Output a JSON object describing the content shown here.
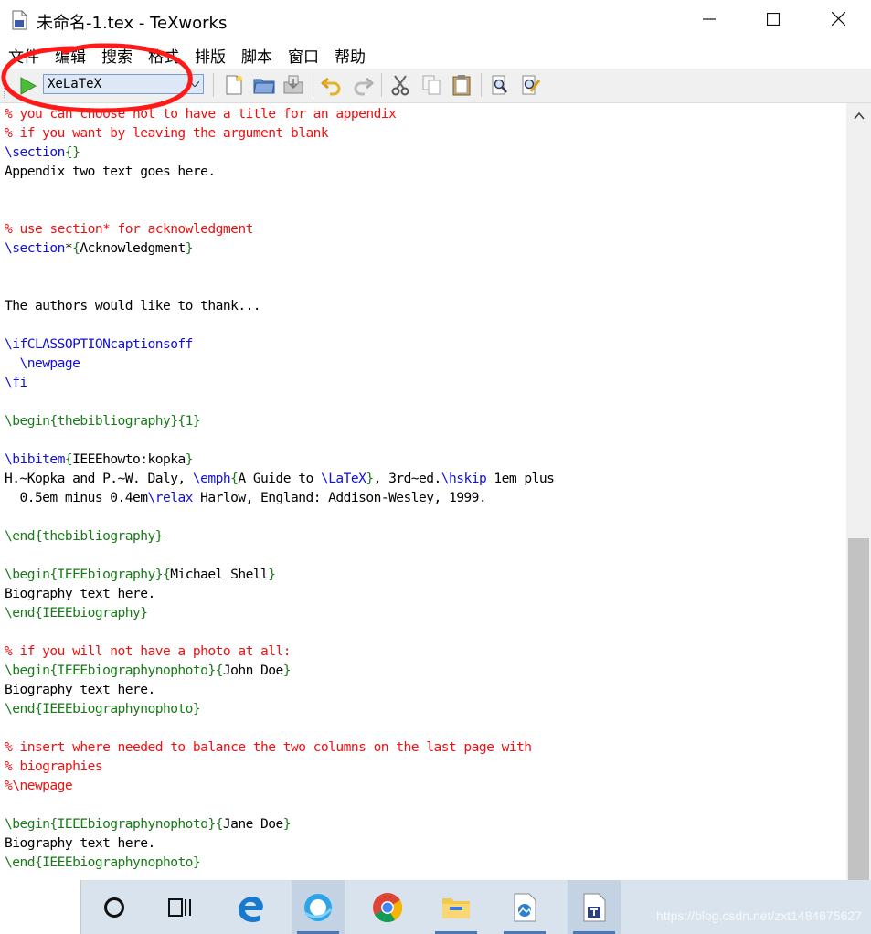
{
  "window": {
    "title": "未命名-1.tex - TeXworks",
    "minimize": "—",
    "maximize": "☐",
    "close": "✕"
  },
  "menu": [
    "文件",
    "编辑",
    "搜索",
    "格式",
    "排版",
    "脚本",
    "窗口",
    "帮助"
  ],
  "toolbar": {
    "engine": "XeLaTeX",
    "icons": [
      "run-icon",
      "new-icon",
      "open-icon",
      "save-icon",
      "undo-icon",
      "redo-icon",
      "cut-icon",
      "copy-icon",
      "paste-icon",
      "find-icon",
      "replace-icon"
    ]
  },
  "editor": {
    "lines": [
      [
        {
          "t": "% you can choose not to have a title for an appendix",
          "k": "comment"
        }
      ],
      [
        {
          "t": "% if you want by leaving the argument blank",
          "k": "comment"
        }
      ],
      [
        {
          "t": "\\section",
          "k": "cmd"
        },
        {
          "t": "{}",
          "k": "brace"
        }
      ],
      [
        {
          "t": "Appendix two text goes here.",
          "k": "text"
        }
      ],
      [],
      [],
      [
        {
          "t": "% use section* for acknowledgment",
          "k": "comment"
        }
      ],
      [
        {
          "t": "\\section",
          "k": "cmd"
        },
        {
          "t": "*",
          "k": "text"
        },
        {
          "t": "{",
          "k": "brace"
        },
        {
          "t": "Acknowledgment",
          "k": "text"
        },
        {
          "t": "}",
          "k": "brace"
        }
      ],
      [],
      [],
      [
        {
          "t": "The authors would like to thank...",
          "k": "text"
        }
      ],
      [],
      [
        {
          "t": "\\ifCLASSOPTIONcaptionsoff",
          "k": "cmd"
        }
      ],
      [
        {
          "t": "  ",
          "k": "text"
        },
        {
          "t": "\\newpage",
          "k": "cmd"
        }
      ],
      [
        {
          "t": "\\fi",
          "k": "cmd"
        }
      ],
      [],
      [
        {
          "t": "\\begin",
          "k": "brace"
        },
        {
          "t": "{thebibliography}{1}",
          "k": "brace"
        }
      ],
      [],
      [
        {
          "t": "\\bibitem",
          "k": "cmd"
        },
        {
          "t": "{",
          "k": "brace"
        },
        {
          "t": "IEEEhowto:kopka",
          "k": "text"
        },
        {
          "t": "}",
          "k": "brace"
        }
      ],
      [
        {
          "t": "H.~Kopka and P.~W. Daly, ",
          "k": "text"
        },
        {
          "t": "\\emph",
          "k": "cmd"
        },
        {
          "t": "{",
          "k": "brace"
        },
        {
          "t": "A Guide to ",
          "k": "text"
        },
        {
          "t": "\\LaTeX",
          "k": "cmd"
        },
        {
          "t": "}",
          "k": "brace"
        },
        {
          "t": ", 3rd~ed.",
          "k": "text"
        },
        {
          "t": "\\hskip",
          "k": "cmd"
        },
        {
          "t": " 1em plus",
          "k": "text"
        }
      ],
      [
        {
          "t": "  0.5em minus 0.4em",
          "k": "text"
        },
        {
          "t": "\\relax",
          "k": "cmd"
        },
        {
          "t": " Harlow, England: Addison-Wesley, 1999.",
          "k": "text"
        }
      ],
      [],
      [
        {
          "t": "\\end",
          "k": "brace"
        },
        {
          "t": "{thebibliography}",
          "k": "brace"
        }
      ],
      [],
      [
        {
          "t": "\\begin",
          "k": "brace"
        },
        {
          "t": "{IEEEbiography}",
          "k": "brace"
        },
        {
          "t": "{",
          "k": "brace"
        },
        {
          "t": "Michael Shell",
          "k": "text"
        },
        {
          "t": "}",
          "k": "brace"
        }
      ],
      [
        {
          "t": "Biography text here.",
          "k": "text"
        }
      ],
      [
        {
          "t": "\\end",
          "k": "brace"
        },
        {
          "t": "{IEEEbiography}",
          "k": "brace"
        }
      ],
      [],
      [
        {
          "t": "% if you will not have a photo at all:",
          "k": "comment"
        }
      ],
      [
        {
          "t": "\\begin",
          "k": "brace"
        },
        {
          "t": "{IEEEbiographynophoto}",
          "k": "brace"
        },
        {
          "t": "{",
          "k": "brace"
        },
        {
          "t": "John Doe",
          "k": "text"
        },
        {
          "t": "}",
          "k": "brace"
        }
      ],
      [
        {
          "t": "Biography text here.",
          "k": "text"
        }
      ],
      [
        {
          "t": "\\end",
          "k": "brace"
        },
        {
          "t": "{IEEEbiographynophoto}",
          "k": "brace"
        }
      ],
      [],
      [
        {
          "t": "% insert where needed to balance the two columns on the last page with",
          "k": "comment"
        }
      ],
      [
        {
          "t": "% biographies",
          "k": "comment"
        }
      ],
      [
        {
          "t": "%\\newpage",
          "k": "comment"
        }
      ],
      [],
      [
        {
          "t": "\\begin",
          "k": "brace"
        },
        {
          "t": "{IEEEbiographynophoto}",
          "k": "brace"
        },
        {
          "t": "{",
          "k": "brace"
        },
        {
          "t": "Jane Doe",
          "k": "text"
        },
        {
          "t": "}",
          "k": "brace"
        }
      ],
      [
        {
          "t": "Biography text here.",
          "k": "text"
        }
      ],
      [
        {
          "t": "\\end",
          "k": "brace"
        },
        {
          "t": "{IEEEbiographynophoto}",
          "k": "brace"
        }
      ]
    ]
  },
  "taskbar": {
    "apps": [
      "cortana-icon",
      "task-view-icon",
      "edge-icon",
      "qq-browser-icon",
      "chrome-icon",
      "file-explorer-icon",
      "photos-icon",
      "texworks-icon"
    ],
    "watermark": "https://blog.csdn.net/zxt1484675627"
  },
  "colors": {
    "comment": "#ee1111",
    "command": "#1010dd",
    "brace": "#1a7a1a",
    "annotation": "#ff1a1a"
  }
}
